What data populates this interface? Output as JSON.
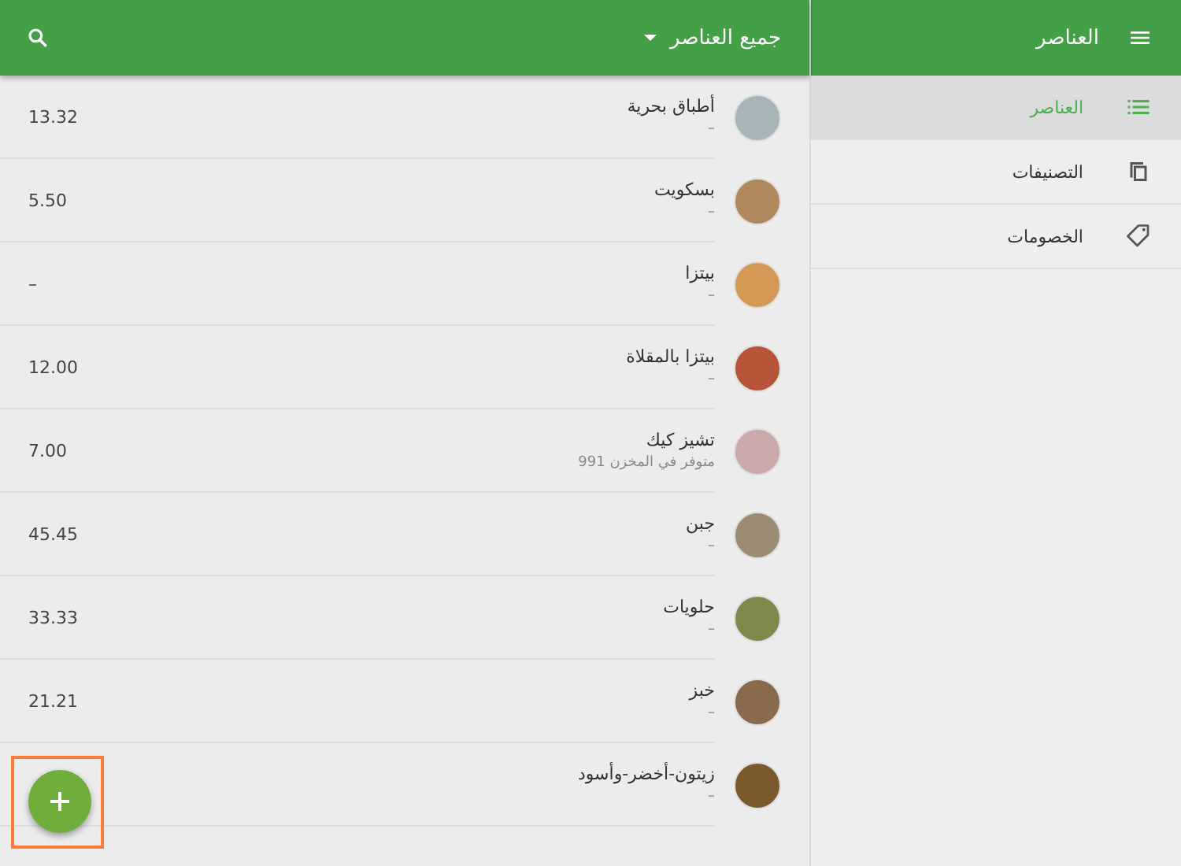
{
  "app_bar": {
    "menu_title": "العناصر",
    "filter": "جميع العناصر"
  },
  "sidebar": {
    "items": [
      {
        "label": "العناصر",
        "kind": "list",
        "selected": true
      },
      {
        "label": "التصنيفات",
        "kind": "copy",
        "selected": false
      },
      {
        "label": "الخصومات",
        "kind": "tag",
        "selected": false
      }
    ]
  },
  "items": [
    {
      "name": "أطباق بحرية",
      "subtitle": "–",
      "price": "13.32",
      "color": "#a7b4b8"
    },
    {
      "name": "بسكويت",
      "subtitle": "–",
      "price": "5.50",
      "color": "#b08a5e"
    },
    {
      "name": "بيتزا",
      "subtitle": "–",
      "price": "–",
      "color": "#d49a55"
    },
    {
      "name": "بيتزا بالمقلاة",
      "subtitle": "–",
      "price": "12.00",
      "color": "#b7553a"
    },
    {
      "name": "تشيز كيك",
      "subtitle": "991 متوفر في المخزن",
      "price": "7.00",
      "color": "#c9a9a9"
    },
    {
      "name": "جبن",
      "subtitle": "–",
      "price": "45.45",
      "color": "#9c8c74"
    },
    {
      "name": "حلويات",
      "subtitle": "–",
      "price": "33.33",
      "color": "#7d8a4c"
    },
    {
      "name": "خبز",
      "subtitle": "–",
      "price": "21.21",
      "color": "#8a6a4c"
    },
    {
      "name": "زيتون-أخضر-وأسود",
      "subtitle": "–",
      "color": "#7a5a2c"
    }
  ]
}
